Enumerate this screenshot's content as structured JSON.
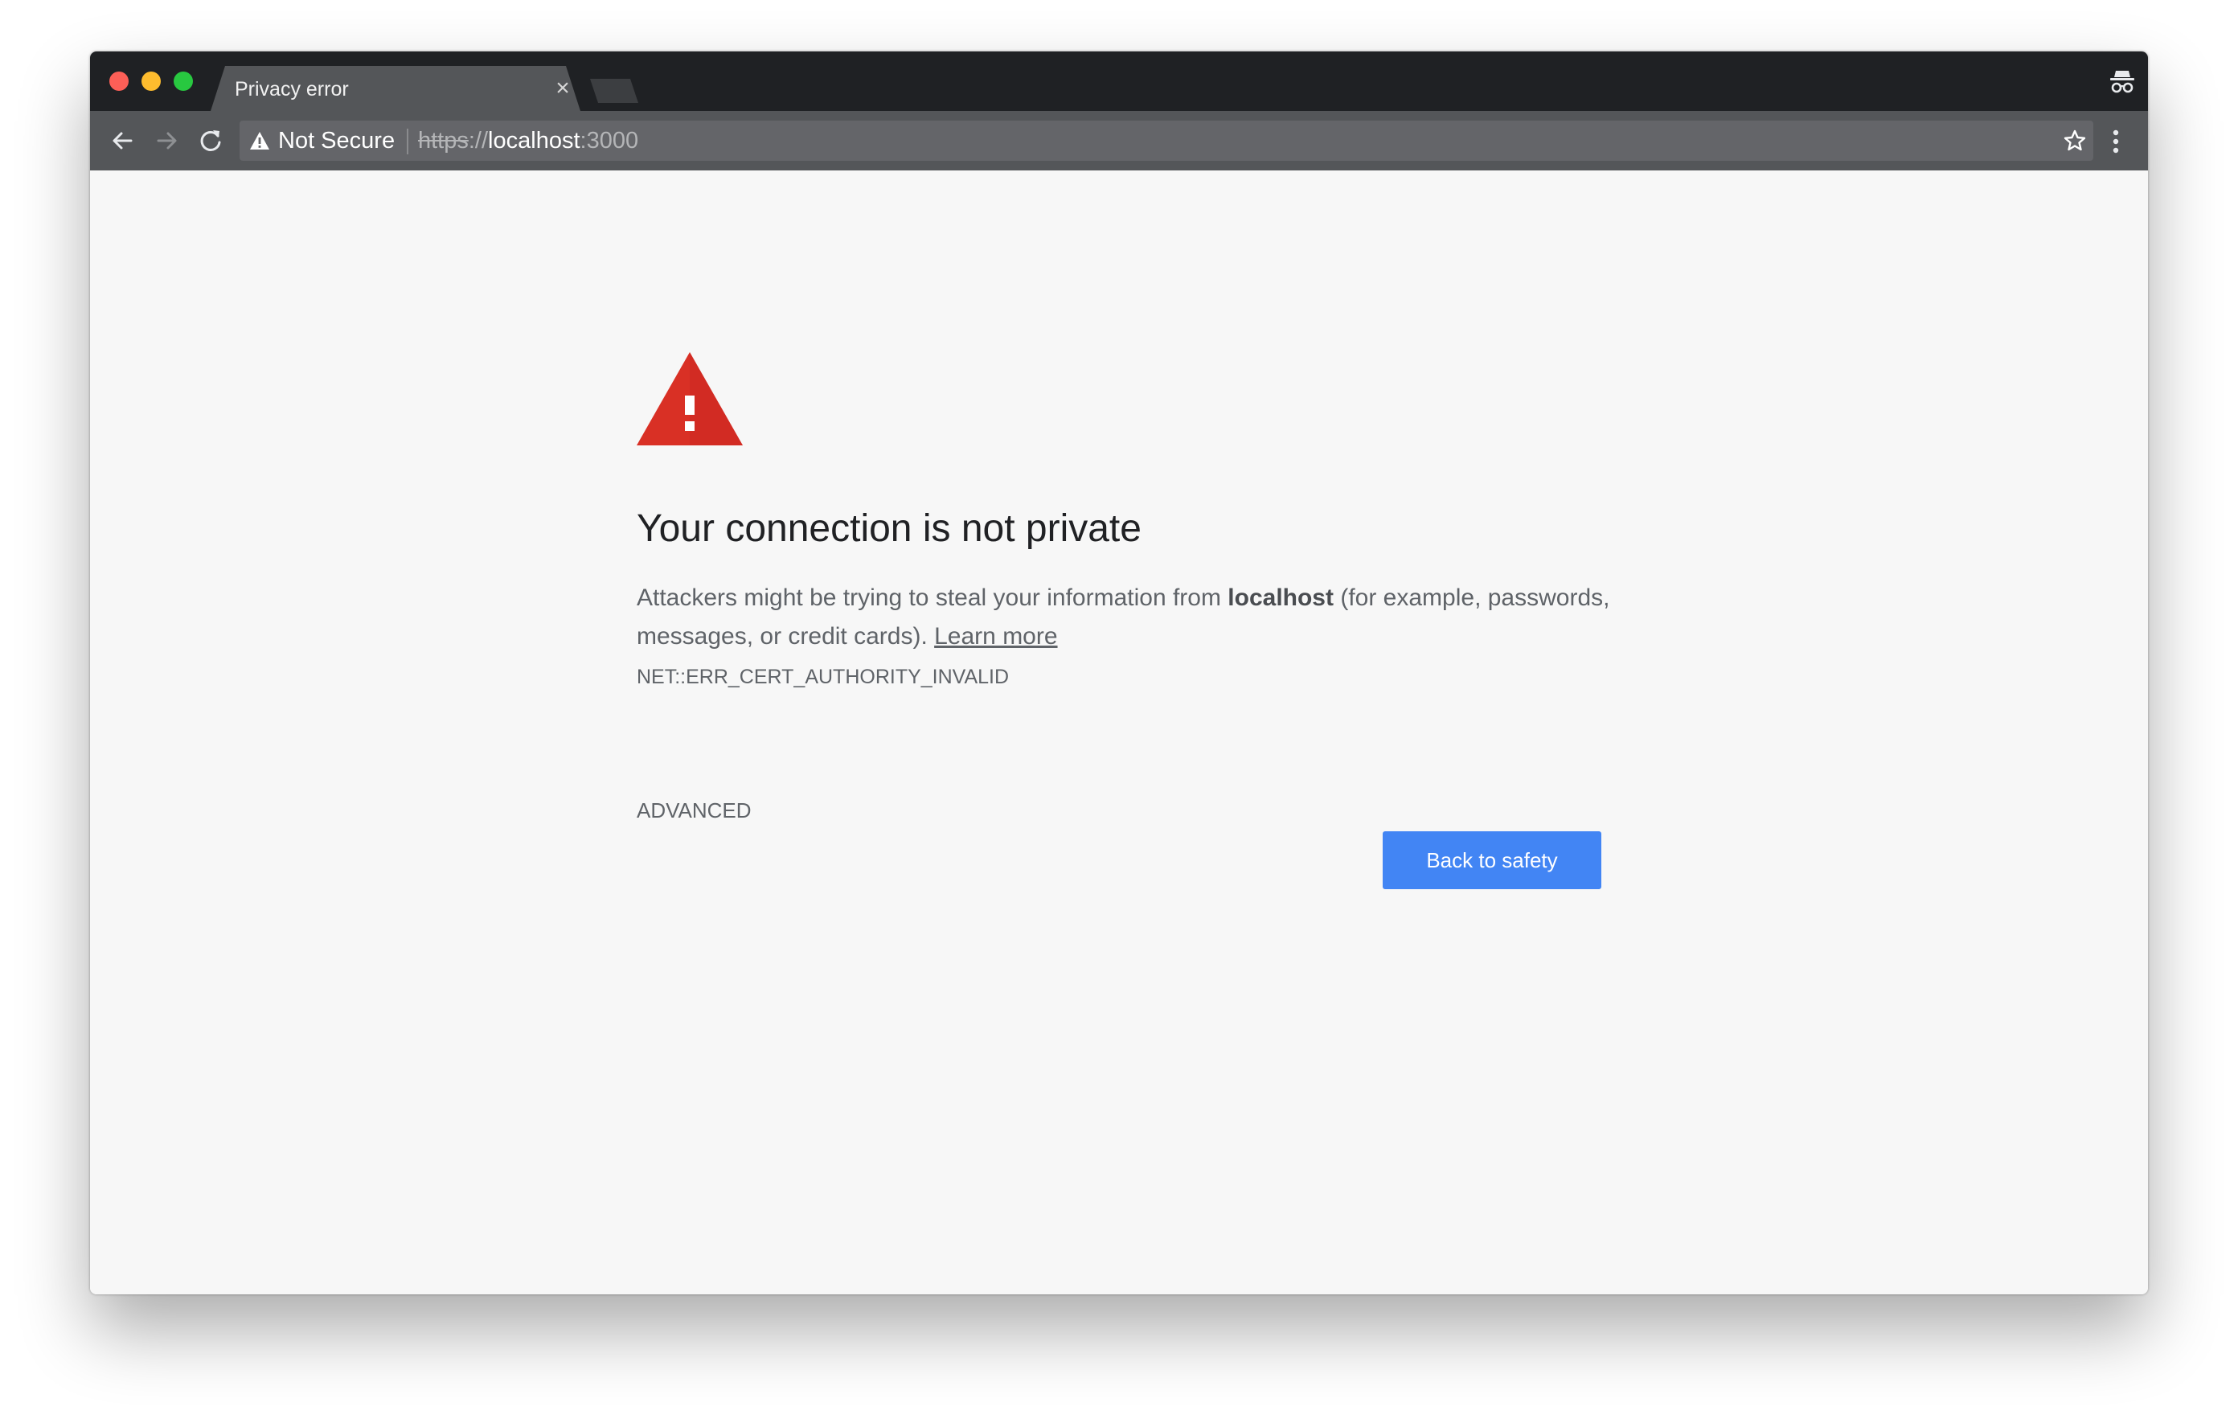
{
  "browser": {
    "tab": {
      "title": "Privacy error",
      "close_glyph": "×"
    },
    "icons": {
      "incognito": "incognito-icon",
      "back": "back-arrow-icon",
      "forward": "forward-arrow-icon",
      "reload": "reload-icon",
      "warning": "warning-icon",
      "star": "star-icon",
      "menu": "more-vert-icon"
    },
    "omnibox": {
      "security_label": "Not Secure",
      "url_scheme": "https",
      "url_separator": "://",
      "url_host": "localhost",
      "url_port": ":3000"
    }
  },
  "page": {
    "heading": "Your connection is not private",
    "intro_text": "Attackers might be trying to steal your information from ",
    "site": "localhost",
    "outro_text": " (for example, passwords, messages, or credit cards). ",
    "learn_more": "Learn more",
    "error_code": "NET::ERR_CERT_AUTHORITY_INVALID",
    "advanced_label": "ADVANCED",
    "back_label": "Back to safety"
  },
  "colors": {
    "primary_button": "#4285f4",
    "error_icon": "#d93025",
    "page_background": "#f7f7f7"
  }
}
